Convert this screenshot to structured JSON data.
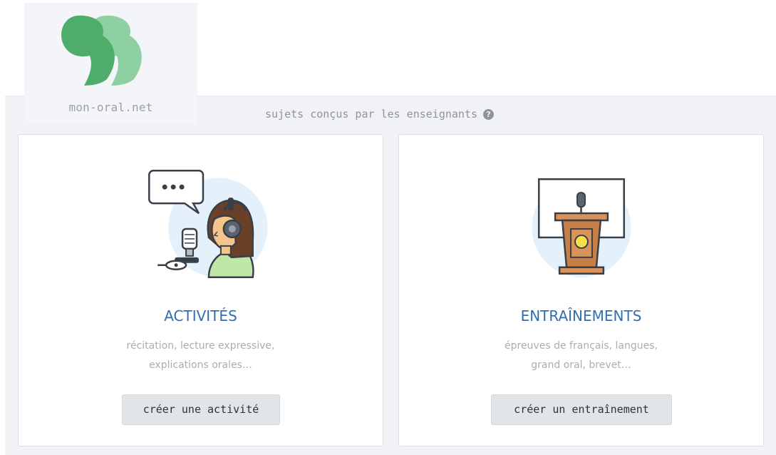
{
  "logo": {
    "text": "mon-oral.net",
    "icon": "quote-marks-logo",
    "colors": [
      "#4fad6b",
      "#8fd0a2"
    ]
  },
  "tagline": {
    "text": "sujets conçus par les enseignants",
    "icon": "help-circle-icon"
  },
  "cards": [
    {
      "title": "ACTIVITÉS",
      "desc_line1": "récitation, lecture expressive,",
      "desc_line2": "explications orales…",
      "button": "créer une activité",
      "illustration": "student-headset-microphone-icon"
    },
    {
      "title": "ENTRAÎNEMENTS",
      "desc_line1": "épreuves de français, langues,",
      "desc_line2": "grand oral, brevet…",
      "button": "créer un entraînement",
      "illustration": "lectern-podium-icon"
    }
  ],
  "colors": {
    "accent": "#2f6fb0",
    "panel_bg": "#f1f2f5",
    "button_bg": "#e1e4e9"
  }
}
